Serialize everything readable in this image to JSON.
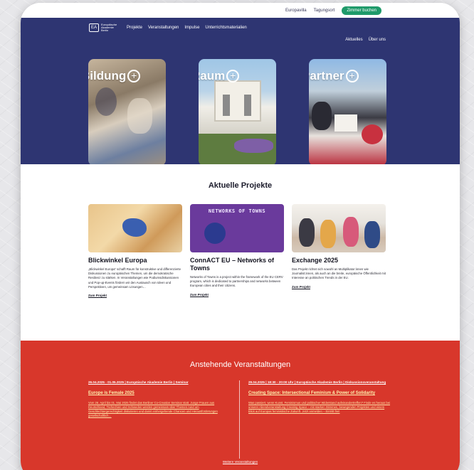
{
  "topbar": {
    "link1": "Europavilla",
    "link2": "Tagungsort",
    "cta": "Zimmer buchen"
  },
  "nav": {
    "logo_mark": "EA",
    "logo_text": "Europäische Akademie Berlin",
    "items": [
      "Projekte",
      "Veranstaltungen",
      "Impulse",
      "Unterrichtsmaterialien"
    ],
    "right": [
      "Aktuelles",
      "Über uns"
    ]
  },
  "tiles": [
    {
      "label": "Bildung"
    },
    {
      "label": "Raum"
    },
    {
      "label": "Partner"
    }
  ],
  "projects": {
    "title": "Aktuelle Projekte",
    "cards": [
      {
        "title": "Blickwinkel Europa",
        "text": "„Blickwinkel Europa“ schafft Raum für konstruktive und differenzierte Diskussionen zu europäischen Themen, um die demokratische Resilienz zu stärken. In Veranstaltungen wie Podiumsdiskussionen und Pop-up-Events fördern wir den Austausch von Ideen und Perspektiven, um gemeinsam Lösungen…",
        "link": "Zum Projekt"
      },
      {
        "title": "ConnACT EU – Networks of Towns",
        "image_text": "NETWORKS OF TOWNS",
        "text": "Networks of Towns is a project within the framework of the EU CERV program, which is dedicated to partnerships and networks between European cities and their citizens.",
        "link": "Zum Projekt"
      },
      {
        "title": "Exchange 2025",
        "text": "Das Projekt richtet sich sowohl an Multiplikator:innen wie Journalist:innen, als auch an die breite, europäische Öffentlichkeit mit Interesse an politischen Trends in der EU.",
        "link": "Zum Projekt"
      }
    ]
  },
  "events": {
    "title": "Anstehende Veranstaltungen",
    "items": [
      {
        "meta": "26.04.2025 - 01.05.2025 | Europäische Akademie Berlin | Seminar",
        "title": "Europe is Female 2025",
        "text": "Vom 26. April bis 01. Mai 2025 findet das Berliner Co-Creation Seminar statt. Junge Frauen aus Deutschland, Tschechien und Schweden werden gemeinsam über Themen rund um Geschlechtergerechtigkeit diskutieren und damit einhergehende Chancen und Herausforderungen gesellschaftlich…"
      },
      {
        "meta": "29.04.2025 | 18:30 - 20:00 Uhr | Europäische Akademie Berlin | Diskussionsveranstaltung",
        "title": "Creating Space: Intersectional Feminism & Power of Solidarity",
        "text": "Was passiert, wenn Kunst, Feminismus und politischer Widerstand aufeinandertreffen? Finde es heraus bei unserer Abendveranstaltung Creating Space – mit starken Stimmen, bewegenden Projekten und einem Blick auf Europas feministische Zukunft. Jetzt anmelden – Eintritt frei!"
      }
    ],
    "more": "Weitere Veranstaltungen"
  }
}
